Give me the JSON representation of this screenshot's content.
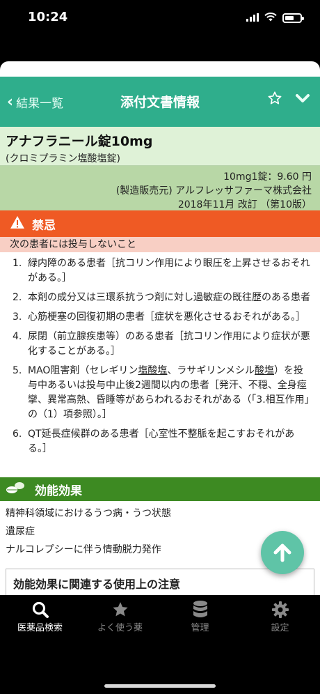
{
  "status": {
    "time": "10:24"
  },
  "nav": {
    "back_label": "結果一覧",
    "title": "添付文書情報"
  },
  "drug": {
    "name": "アナフラニール錠10mg",
    "generic": "(クロミプラミン塩酸塩錠)",
    "price": "10mg1錠：9.60 円",
    "maker": "(製造販売元) アルフレッサファーマ株式会社",
    "revision": "2018年11月 改訂 （第10版）"
  },
  "contraindication": {
    "title": "禁忌",
    "subtitle": "次の患者には投与しないこと",
    "items": [
      {
        "num": "1.",
        "text": "緑内障のある患者［抗コリン作用により眼圧を上昇させるおそれがある。］"
      },
      {
        "num": "2.",
        "text": "本剤の成分又は三環系抗うつ剤に対し過敏症の既往歴のある患者"
      },
      {
        "num": "3.",
        "text": "心筋梗塞の回復初期の患者［症状を悪化させるおそれがある。］"
      },
      {
        "num": "4.",
        "text": "尿閉（前立腺疾患等）のある患者［抗コリン作用により症状が悪化することがある。］"
      },
      {
        "num": "5.",
        "text_a": "MAO阻害剤（セレギリン",
        "text_u1": "塩酸塩",
        "text_b": "、ラサギリンメシル",
        "text_u2": "酸塩",
        "text_c": "）を投与中あるいは投与中止後2週間以内の患者［発汗、不穏、全身痙攣、異常高熱、昏睡等があらわれるおそれがある（「3.相互作用」の（1）項参照）。］"
      },
      {
        "num": "6.",
        "text": "QT延長症候群のある患者［心室性不整脈を起こすおそれがある。］"
      }
    ]
  },
  "effects": {
    "title": "効能効果",
    "items": [
      "精神科領域におけるうつ病・うつ状態",
      "遺尿症",
      "ナルコレプシーに伴う情動脱力発作"
    ],
    "note_title": "効能効果に関連する使用上の注意"
  },
  "tabs": [
    {
      "label": "医薬品検索",
      "icon": "search-icon",
      "active": true
    },
    {
      "label": "よく使う薬",
      "icon": "star-icon",
      "active": false
    },
    {
      "label": "管理",
      "icon": "database-icon",
      "active": false
    },
    {
      "label": "設定",
      "icon": "gear-icon",
      "active": false
    }
  ],
  "colors": {
    "nav": "#2fae8c",
    "drug_header": "#dff2d7",
    "drug_meta": "#b8d7a6",
    "contraindication": "#ef5a24",
    "contraindication_sub": "#f8cfc4",
    "effects": "#3d8a22",
    "fab": "#5fc4a7"
  }
}
